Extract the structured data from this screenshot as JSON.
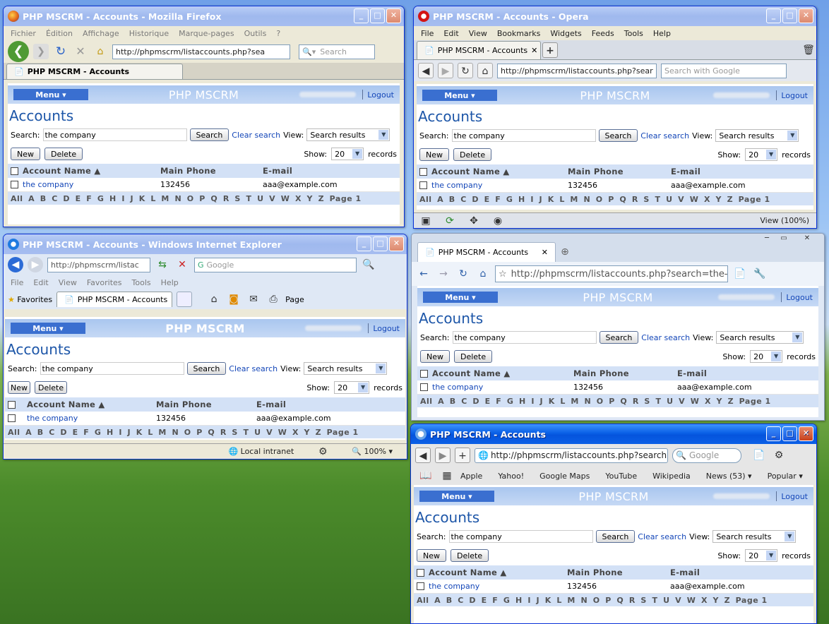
{
  "app": {
    "menu": "Menu ▾",
    "title": "PHP MSCRM",
    "logout": "Logout",
    "heading": "Accounts",
    "search_label": "Search:",
    "search_value": "the company",
    "search_btn": "Search",
    "clear": "Clear search",
    "view_label": "View:",
    "view_value": "Search results",
    "new": "New",
    "delete": "Delete",
    "show": "Show:",
    "show_value": "20",
    "records": "records",
    "col_name": "Account Name ▲",
    "col_phone": "Main Phone",
    "col_email": "E-mail",
    "row_name": "the company",
    "row_phone": "132456",
    "row_email": "aaa@example.com",
    "letters": [
      "All",
      "A",
      "B",
      "C",
      "D",
      "E",
      "F",
      "G",
      "H",
      "I",
      "J",
      "K",
      "L",
      "M",
      "N",
      "O",
      "P",
      "Q",
      "R",
      "S",
      "T",
      "U",
      "V",
      "W",
      "X",
      "Y",
      "Z",
      "Page 1"
    ]
  },
  "firefox": {
    "title": "PHP MSCRM - Accounts - Mozilla Firefox",
    "menus": [
      "Fichier",
      "Édition",
      "Affichage",
      "Historique",
      "Marque-pages",
      "Outils",
      "?"
    ],
    "url": "http://phpmscrm/listaccounts.php?sea",
    "search_ph": "Search",
    "tab": "PHP MSCRM - Accounts"
  },
  "opera": {
    "title": "PHP MSCRM - Accounts - Opera",
    "menus": [
      "File",
      "Edit",
      "View",
      "Bookmarks",
      "Widgets",
      "Feeds",
      "Tools",
      "Help"
    ],
    "tab": "PHP MSCRM - Accounts",
    "url": "http://phpmscrm/listaccounts.php?sear",
    "search_ph": "Search with Google",
    "zoom": "View (100%)"
  },
  "ie": {
    "title": "PHP MSCRM - Accounts - Windows Internet Explorer",
    "url": "http://phpmscrm/listac",
    "search_ph": "Google",
    "menus": [
      "File",
      "Edit",
      "View",
      "Favorites",
      "Tools",
      "Help"
    ],
    "favorites": "Favorites",
    "tab": "PHP MSCRM - Accounts",
    "page": "Page",
    "zone": "Local intranet",
    "zoom": "100%"
  },
  "chrome": {
    "tab": "PHP MSCRM - Accounts",
    "url": "http://phpmscrm/listaccounts.php?search=the-"
  },
  "safari": {
    "title": "PHP MSCRM - Accounts",
    "url": "http://phpmscrm/listaccounts.php?search=",
    "search_ph": "Google",
    "bookmarks": [
      "Apple",
      "Yahoo!",
      "Google Maps",
      "YouTube",
      "Wikipedia",
      "News (53) ▾",
      "Popular ▾"
    ]
  }
}
